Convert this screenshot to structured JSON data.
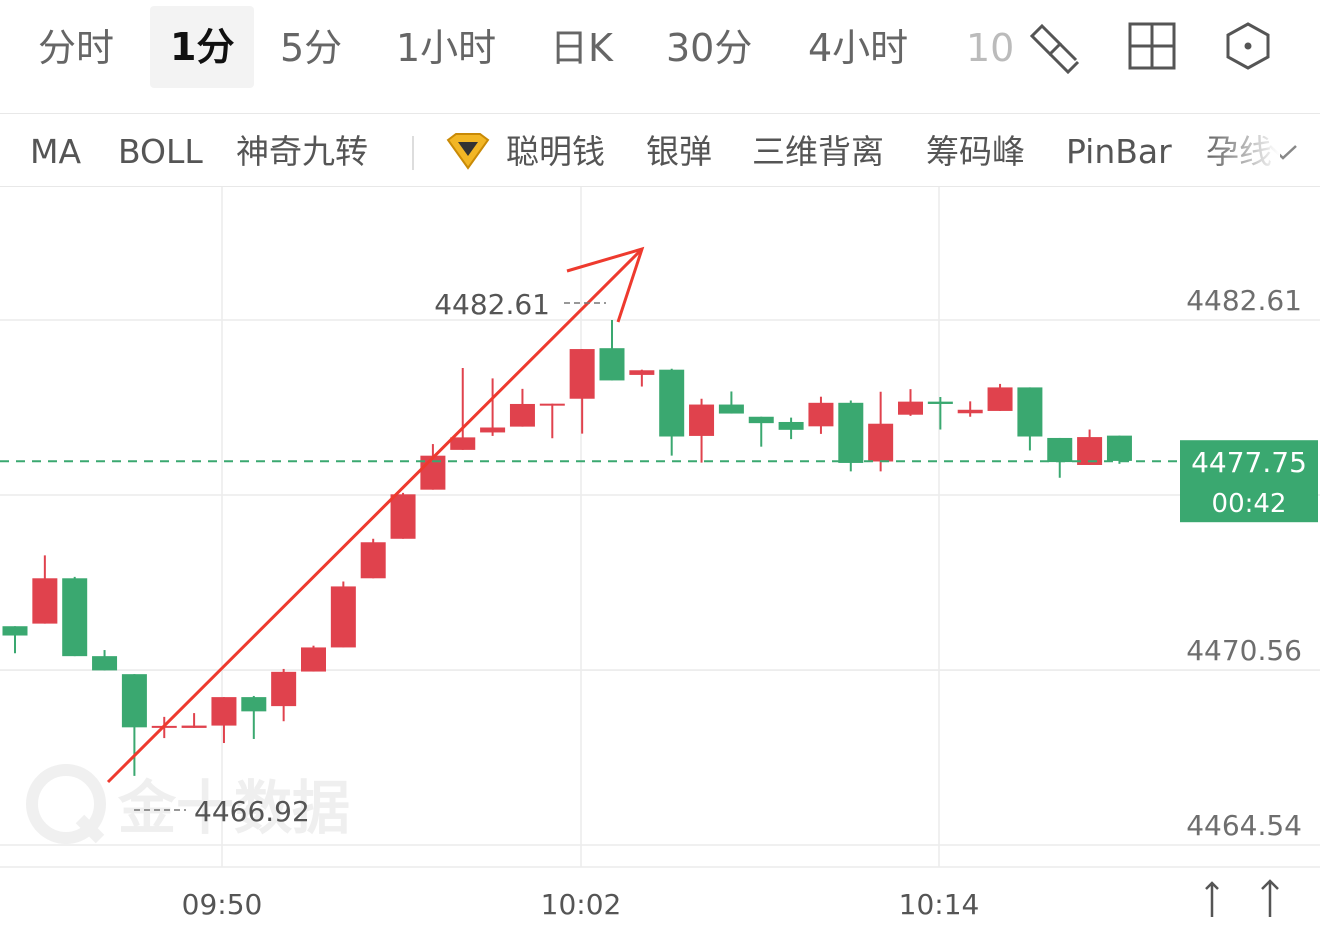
{
  "tabs": [
    {
      "id": "fenshi",
      "label": "分时"
    },
    {
      "id": "1m",
      "label": "1分"
    },
    {
      "id": "5m",
      "label": "5分"
    },
    {
      "id": "1h",
      "label": "1小时"
    },
    {
      "id": "day",
      "label": "日K"
    },
    {
      "id": "30m",
      "label": "30分"
    },
    {
      "id": "4h",
      "label": "4小时"
    },
    {
      "id": "more",
      "label": "10"
    }
  ],
  "active_tab": "1分",
  "tool_icons": [
    "draw-tool-icon",
    "layout-grid-icon",
    "settings-hexagon-icon"
  ],
  "indicators": [
    "MA",
    "BOLL",
    "神奇九转",
    "聪明钱",
    "银弹",
    "三维背离",
    "筹码峰",
    "PinBar",
    "孕线"
  ],
  "watermark": "金十数据",
  "colors": {
    "up": "#e0424d",
    "down": "#3aa870",
    "current_line": "#3aa870",
    "arrow": "#ee3a2e",
    "grid": "#ececec",
    "axis_text": "#6e6e6e"
  },
  "chart_data": {
    "type": "candlestick",
    "y_ticks": [
      4482.61,
      4470.56,
      4464.54
    ],
    "ylim": [
      4464.54,
      4482.61
    ],
    "x_ticks": [
      "09:50",
      "10:02",
      "10:14"
    ],
    "high_annotation": {
      "label": "4482.61",
      "value": 4482.61
    },
    "low_annotation": {
      "label": "4466.92",
      "value": 4466.92
    },
    "current_price": {
      "value": "4477.75",
      "countdown": "00:42"
    },
    "candles": [
      {
        "o": 4472.07,
        "c": 4471.75,
        "h": 4472.07,
        "l": 4471.14
      },
      {
        "o": 4472.16,
        "c": 4473.72,
        "h": 4474.51,
        "l": 4472.16
      },
      {
        "o": 4473.72,
        "c": 4471.04,
        "h": 4473.77,
        "l": 4471.04
      },
      {
        "o": 4471.04,
        "c": 4470.55,
        "h": 4471.25,
        "l": 4470.55
      },
      {
        "o": 4470.42,
        "c": 4468.59,
        "h": 4470.42,
        "l": 4466.92
      },
      {
        "o": 4468.59,
        "c": 4468.64,
        "h": 4468.95,
        "l": 4468.22
      },
      {
        "o": 4468.57,
        "c": 4468.65,
        "h": 4469.08,
        "l": 4468.57
      },
      {
        "o": 4468.65,
        "c": 4469.63,
        "h": 4469.63,
        "l": 4468.05
      },
      {
        "o": 4469.63,
        "c": 4469.14,
        "h": 4469.67,
        "l": 4468.19
      },
      {
        "o": 4469.32,
        "c": 4470.5,
        "h": 4470.6,
        "l": 4468.8
      },
      {
        "o": 4470.51,
        "c": 4471.34,
        "h": 4471.4,
        "l": 4470.51
      },
      {
        "o": 4471.34,
        "c": 4473.44,
        "h": 4473.61,
        "l": 4471.34
      },
      {
        "o": 4473.72,
        "c": 4474.96,
        "h": 4475.08,
        "l": 4473.72
      },
      {
        "o": 4475.08,
        "c": 4476.61,
        "h": 4476.66,
        "l": 4475.08
      },
      {
        "o": 4476.77,
        "c": 4477.94,
        "h": 4478.34,
        "l": 4476.77
      },
      {
        "o": 4478.14,
        "c": 4478.57,
        "h": 4480.96,
        "l": 4478.14
      },
      {
        "o": 4478.74,
        "c": 4478.91,
        "h": 4480.6,
        "l": 4478.62
      },
      {
        "o": 4478.94,
        "c": 4479.72,
        "h": 4480.24,
        "l": 4478.94
      },
      {
        "o": 4479.7,
        "c": 4479.73,
        "h": 4479.73,
        "l": 4478.54
      },
      {
        "o": 4479.9,
        "c": 4481.61,
        "h": 4481.61,
        "l": 4478.7
      },
      {
        "o": 4481.64,
        "c": 4480.53,
        "h": 4482.61,
        "l": 4480.53
      },
      {
        "o": 4480.72,
        "c": 4480.88,
        "h": 4480.9,
        "l": 4480.32
      },
      {
        "o": 4480.9,
        "c": 4478.6,
        "h": 4480.93,
        "l": 4477.94
      },
      {
        "o": 4478.62,
        "c": 4479.7,
        "h": 4479.9,
        "l": 4477.7
      },
      {
        "o": 4479.7,
        "c": 4479.39,
        "h": 4480.15,
        "l": 4479.39
      },
      {
        "o": 4479.28,
        "c": 4479.06,
        "h": 4479.28,
        "l": 4478.25
      },
      {
        "o": 4479.1,
        "c": 4478.83,
        "h": 4479.25,
        "l": 4478.51
      },
      {
        "o": 4478.95,
        "c": 4479.76,
        "h": 4479.97,
        "l": 4478.69
      },
      {
        "o": 4479.76,
        "c": 4477.69,
        "h": 4479.84,
        "l": 4477.4
      },
      {
        "o": 4477.74,
        "c": 4479.04,
        "h": 4480.14,
        "l": 4477.4
      },
      {
        "o": 4479.35,
        "c": 4479.8,
        "h": 4480.23,
        "l": 4479.31
      },
      {
        "o": 4479.8,
        "c": 4479.72,
        "h": 4479.96,
        "l": 4478.84
      },
      {
        "o": 4479.4,
        "c": 4479.52,
        "h": 4479.81,
        "l": 4479.28
      },
      {
        "o": 4479.48,
        "c": 4480.29,
        "h": 4480.41,
        "l": 4479.48
      },
      {
        "o": 4480.29,
        "c": 4478.6,
        "h": 4480.29,
        "l": 4478.12
      },
      {
        "o": 4478.55,
        "c": 4477.72,
        "h": 4478.55,
        "l": 4477.18
      },
      {
        "o": 4477.62,
        "c": 4478.58,
        "h": 4478.84,
        "l": 4477.62
      },
      {
        "o": 4478.63,
        "c": 4477.76,
        "h": 4478.63,
        "l": 4477.66
      }
    ]
  }
}
